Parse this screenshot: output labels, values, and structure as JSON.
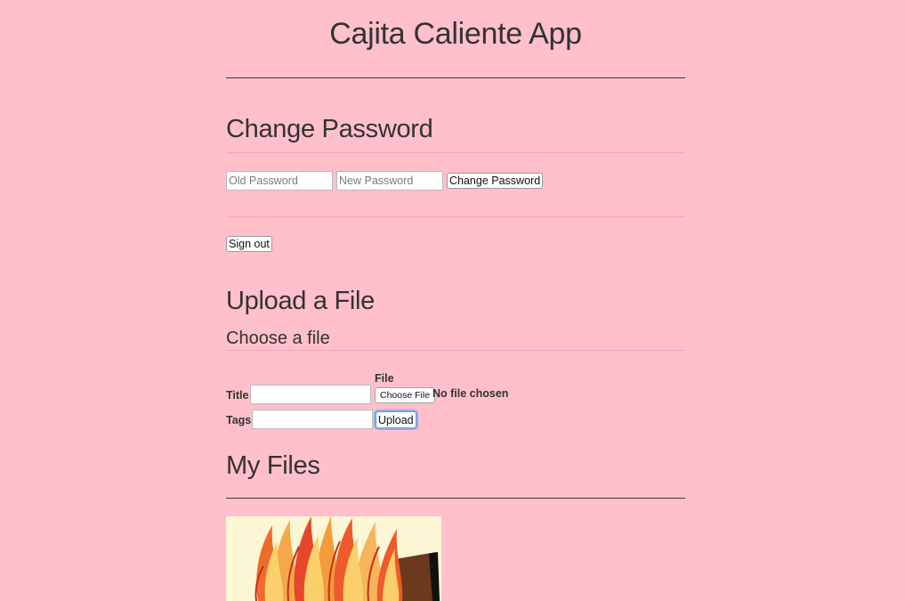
{
  "app": {
    "title": "Cajita Caliente App"
  },
  "change_password": {
    "heading": "Change Password",
    "old_password_placeholder": "Old Password",
    "old_password_value": "",
    "new_password_placeholder": "New Password",
    "new_password_value": "",
    "submit_label": "Change Password"
  },
  "sign_out": {
    "label": "Sign out"
  },
  "upload": {
    "heading": "Upload a File",
    "subheading": "Choose a file",
    "title_label": "Title",
    "title_value": "",
    "file_label": "File",
    "choose_file_label": "Choose File",
    "file_status": "No file chosen",
    "tags_label": "Tags",
    "tags_value": "",
    "upload_label": "Upload"
  },
  "my_files": {
    "heading": "My Files",
    "items": [
      {
        "kind": "image-thumbnail"
      }
    ]
  },
  "colors": {
    "background": "#ffbfcb",
    "text": "#333333",
    "rule": "#3a3a3a"
  }
}
